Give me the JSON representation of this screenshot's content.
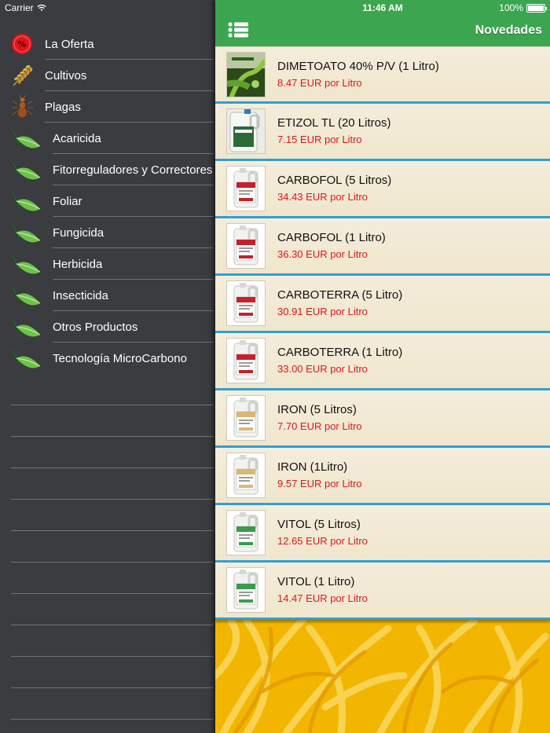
{
  "status_bar": {
    "carrier": "Carrier",
    "time": "11:46 AM",
    "battery": "100%"
  },
  "navbar": {
    "title": "Novedades"
  },
  "sidebar": {
    "items": [
      {
        "label": "La Oferta",
        "icon": "offer-badge-icon",
        "sub": false
      },
      {
        "label": "Cultivos",
        "icon": "wheat-icon",
        "sub": false
      },
      {
        "label": "Plagas",
        "icon": "ant-icon",
        "sub": false
      },
      {
        "label": "Acaricida",
        "icon": "leaf-icon",
        "sub": true
      },
      {
        "label": "Fitorreguladores y Correctores",
        "icon": "leaf-icon",
        "sub": true
      },
      {
        "label": "Foliar",
        "icon": "leaf-icon",
        "sub": true
      },
      {
        "label": "Fungicida",
        "icon": "leaf-icon",
        "sub": true
      },
      {
        "label": "Herbicida",
        "icon": "leaf-icon",
        "sub": true
      },
      {
        "label": "Insecticida",
        "icon": "leaf-icon",
        "sub": true
      },
      {
        "label": "Otros Productos",
        "icon": "leaf-icon",
        "sub": true
      },
      {
        "label": "Tecnología MicroCarbono",
        "icon": "leaf-icon",
        "sub": true
      }
    ]
  },
  "products": [
    {
      "name": "DIMETOATO 40% P/V (1 Litro)",
      "price": "8.47 EUR por Litro",
      "thumb": "photo-plant",
      "accent": "#3d7d2c"
    },
    {
      "name": "ETIZOL TL (20 Litros)",
      "price": "7.15 EUR por Litro",
      "thumb": "jug-white",
      "accent": "#2d6a3a"
    },
    {
      "name": "CARBOFOL (5 Litros)",
      "price": "34.43 EUR por Litro",
      "thumb": "jug-label",
      "accent": "#c8202a"
    },
    {
      "name": "CARBOFOL (1 Litro)",
      "price": "36.30 EUR por Litro",
      "thumb": "jug-label",
      "accent": "#c8202a"
    },
    {
      "name": "CARBOTERRA (5 Litro)",
      "price": "30.91 EUR por Litro",
      "thumb": "jug-label",
      "accent": "#c8202a"
    },
    {
      "name": "CARBOTERRA (1 Litro)",
      "price": "33.00 EUR por Litro",
      "thumb": "jug-label",
      "accent": "#c8202a"
    },
    {
      "name": "IRON (5 Litros)",
      "price": "7.70 EUR por Litro",
      "thumb": "jug-label",
      "accent": "#d9b873"
    },
    {
      "name": "IRON (1Litro)",
      "price": "9.57 EUR por Litro",
      "thumb": "jug-label",
      "accent": "#d9b873"
    },
    {
      "name": "VITOL (5 Litros)",
      "price": "12.65 EUR por Litro",
      "thumb": "jug-label",
      "accent": "#3a9a4e"
    },
    {
      "name": "VITOL (1 Litro)",
      "price": "14.47 EUR por Litro",
      "thumb": "jug-label",
      "accent": "#3a9a4e"
    }
  ],
  "colors": {
    "sidebar_bg": "#3a3c3f",
    "navbar_green": "#3ba64f",
    "price_red": "#e4161c",
    "row_separator_blue": "#2f9fd6",
    "background_yellow": "#f2b400"
  }
}
